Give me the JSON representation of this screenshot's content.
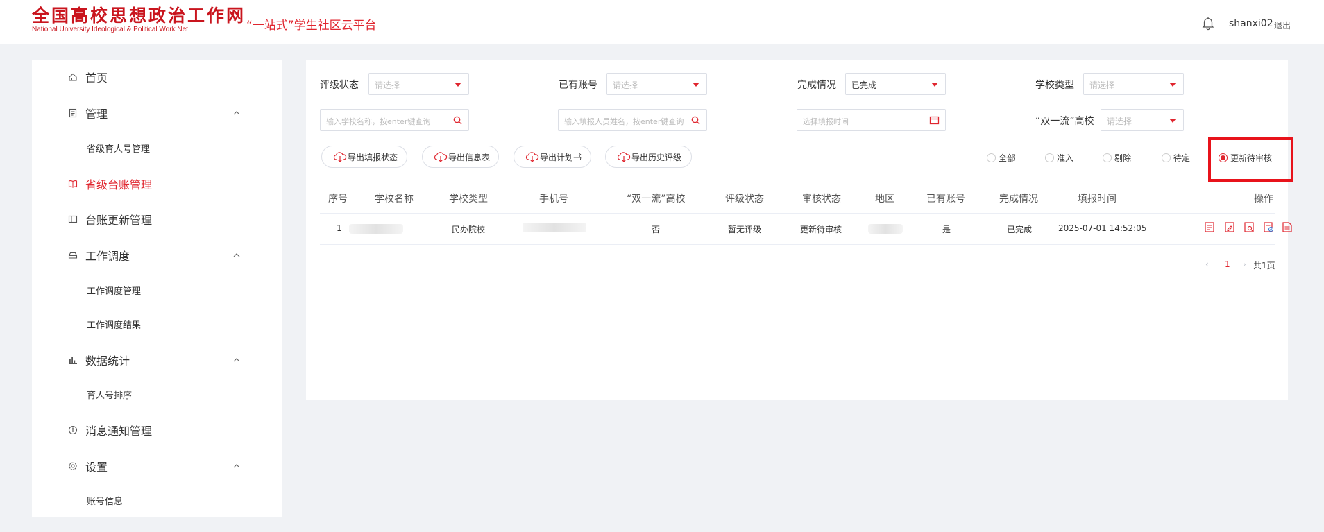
{
  "header": {
    "logo_cn": "全国高校思想政治工作网",
    "logo_en": "National University Ideological & Political Work Net",
    "platform": "“一站式”学生社区云平台",
    "username": "shanxi02",
    "logout": "退出"
  },
  "sidebar": {
    "items": [
      {
        "label": "首页",
        "icon": "home-icon"
      },
      {
        "label": "管理",
        "icon": "document-icon",
        "sub": [
          "省级育人号管理"
        ]
      },
      {
        "label": "省级台账管理",
        "icon": "book-icon",
        "active": true
      },
      {
        "label": "台账更新管理",
        "icon": "panel-icon"
      },
      {
        "label": "工作调度",
        "icon": "tray-icon",
        "sub": [
          "工作调度管理",
          "工作调度结果"
        ]
      },
      {
        "label": "数据统计",
        "icon": "bar-chart-icon",
        "sub": [
          "育人号排序"
        ]
      },
      {
        "label": "消息通知管理",
        "icon": "info-icon"
      },
      {
        "label": "设置",
        "icon": "settings-icon",
        "sub": [
          "账号信息"
        ]
      }
    ]
  },
  "filters": {
    "rating_status": {
      "label": "评级状态",
      "placeholder": "请选择"
    },
    "has_account": {
      "label": "已有账号",
      "placeholder": "请选择"
    },
    "completion": {
      "label": "完成情况",
      "value": "已完成"
    },
    "school_type": {
      "label": "学校类型",
      "placeholder": "请选择"
    },
    "school_search": {
      "placeholder": "输入学校名称，按enter键查询"
    },
    "filler_search": {
      "placeholder": "输入填报人员姓名，按enter键查询"
    },
    "fill_time": {
      "placeholder": "选择填报时间"
    },
    "double_first": {
      "label": "“双一流”高校",
      "placeholder": "请选择"
    }
  },
  "buttons": [
    "导出填报状态",
    "导出信息表",
    "导出计划书",
    "导出历史评级"
  ],
  "radios": [
    {
      "label": "全部",
      "selected": false
    },
    {
      "label": "准入",
      "selected": false
    },
    {
      "label": "剔除",
      "selected": false
    },
    {
      "label": "待定",
      "selected": false
    },
    {
      "label": "更新待审核",
      "selected": true
    }
  ],
  "table": {
    "columns": [
      "序号",
      "学校名称",
      "学校类型",
      "手机号",
      "“双一流”高校",
      "评级状态",
      "审核状态",
      "地区",
      "已有账号",
      "完成情况",
      "填报时间",
      "操作"
    ],
    "rows": [
      {
        "index": "1",
        "school_type": "民办院校",
        "double_first": "否",
        "rating": "暂无评级",
        "audit": "更新待审核",
        "has_account": "是",
        "completion": "已完成",
        "time": "2025-07-01 14:52:05"
      }
    ]
  },
  "pagination": {
    "current": "1",
    "total": "共1页"
  },
  "colors": {
    "accent": "#e0262f",
    "highlight": "#e8131b"
  }
}
